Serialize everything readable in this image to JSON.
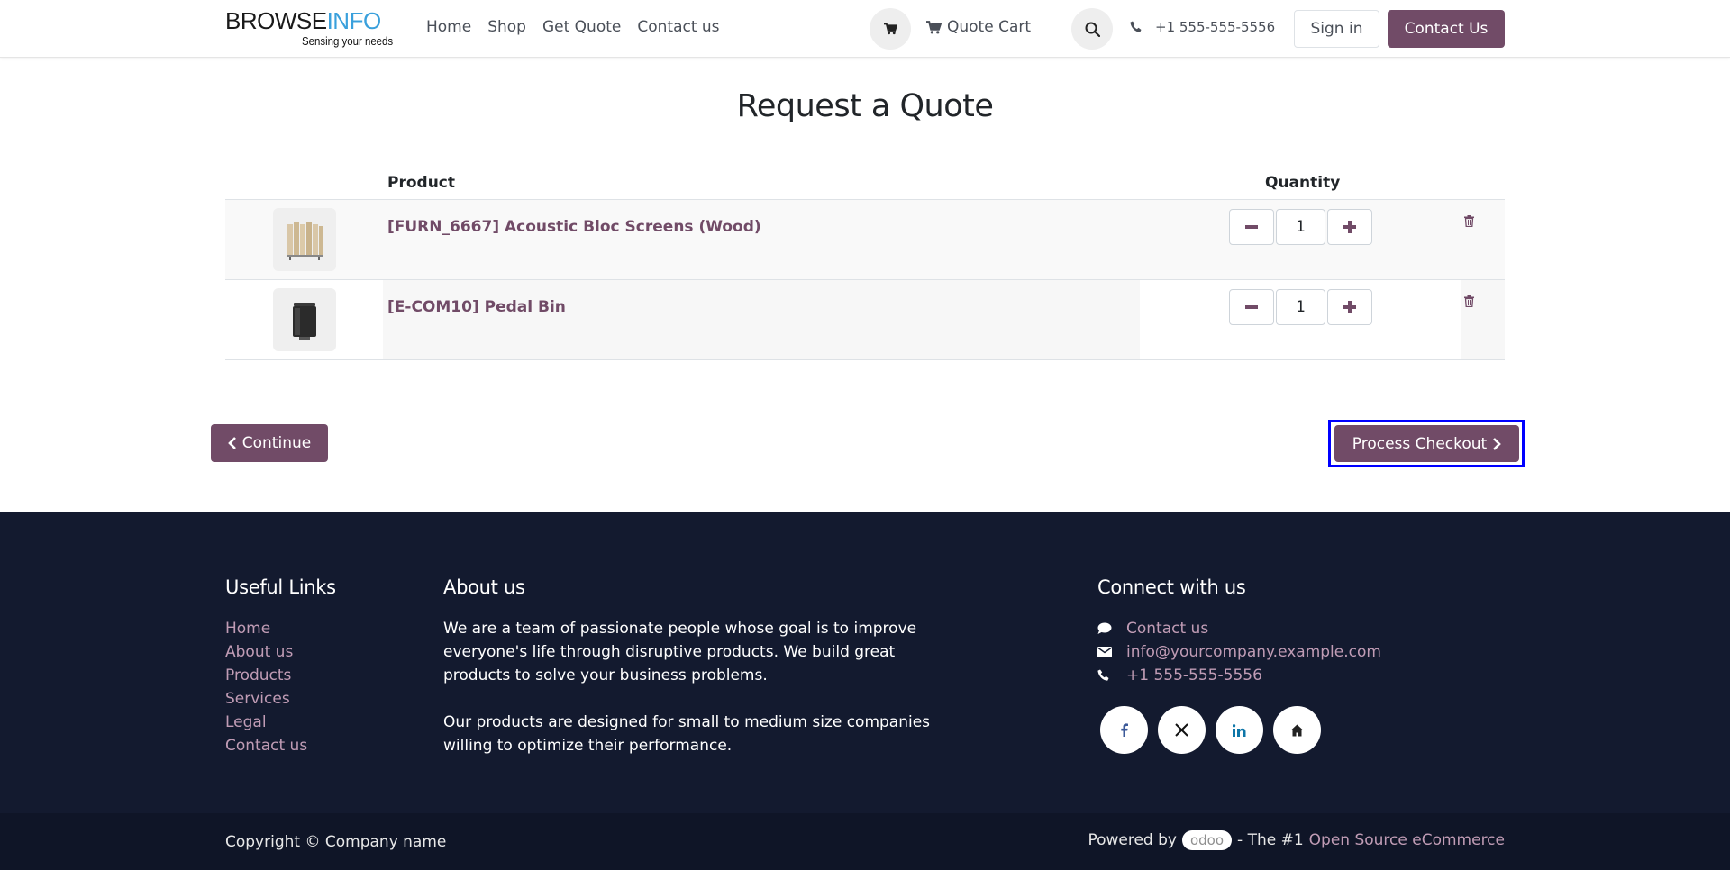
{
  "header": {
    "logo": {
      "main_dark": "BROWSE",
      "main_accent": "INFO",
      "tagline": "Sensing your needs"
    },
    "nav": [
      {
        "label": "Home"
      },
      {
        "label": "Shop"
      },
      {
        "label": "Get Quote"
      },
      {
        "label": "Contact us"
      }
    ],
    "quote_cart_label": "Quote Cart",
    "phone": "+1 555-555-5556",
    "signin_label": "Sign in",
    "contact_button_label": "Contact Us"
  },
  "main": {
    "title": "Request a Quote",
    "columns": {
      "product": "Product",
      "quantity": "Quantity"
    },
    "items": [
      {
        "name": "[FURN_6667] Acoustic Bloc Screens (Wood)",
        "quantity": "1",
        "thumb_icon": "wooden-screen-icon"
      },
      {
        "name": "[E-COM10] Pedal Bin",
        "quantity": "1",
        "thumb_icon": "pedal-bin-icon"
      }
    ],
    "continue_label": "Continue",
    "checkout_label": "Process Checkout"
  },
  "footer": {
    "useful_links": {
      "heading": "Useful Links",
      "links": [
        "Home",
        "About us",
        "Products",
        "Services",
        "Legal",
        "Contact us"
      ]
    },
    "about": {
      "heading": "About us",
      "paragraphs": [
        "We are a team of passionate people whose goal is to improve everyone's life through disruptive products. We build great products to solve your business problems.",
        "Our products are designed for small to medium size companies willing to optimize their performance."
      ]
    },
    "connect": {
      "heading": "Connect with us",
      "contact_label": "Contact us",
      "email": "info@yourcompany.example.com",
      "phone": "+1 555-555-5556",
      "socials": [
        "facebook-icon",
        "x-icon",
        "linkedin-icon",
        "home-icon"
      ]
    },
    "copyright": "Copyright © Company name",
    "powered_by": {
      "prefix": "Powered by",
      "brand": "odoo",
      "middle": "- The #1",
      "link": "Open Source eCommerce"
    }
  },
  "colors": {
    "accent": "#714b67",
    "footer_bg": "#131a2f",
    "footer_link": "#c09cb5",
    "focus_outline": "#0000ff"
  }
}
